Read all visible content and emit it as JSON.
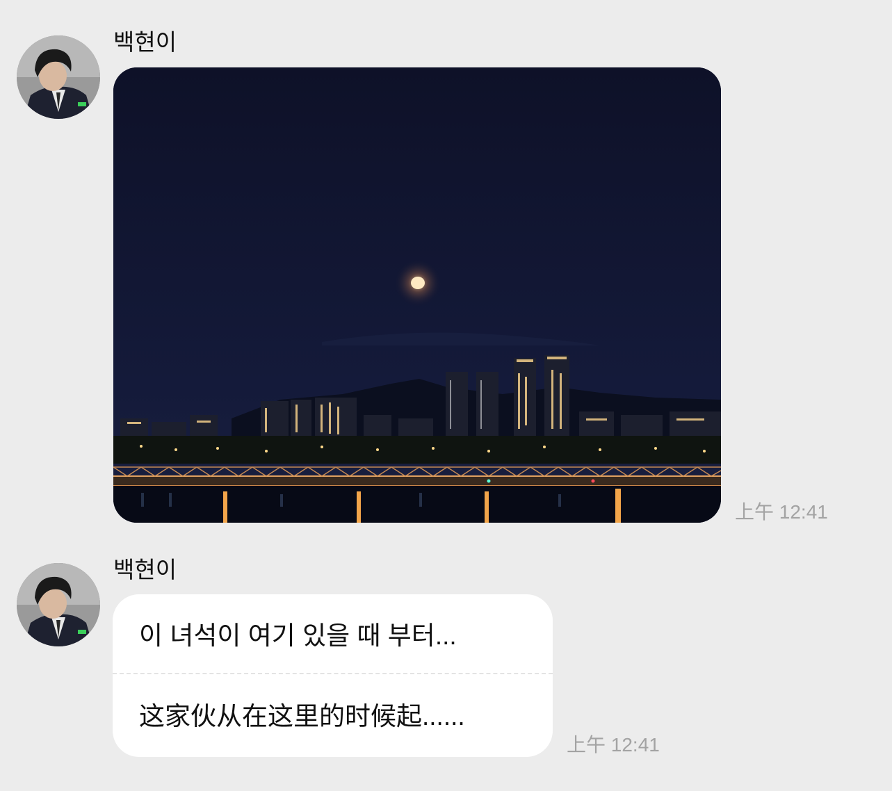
{
  "messages": [
    {
      "sender": "백현이",
      "type": "image",
      "image_alt": "night-city-moon-photo",
      "time": "上午 12:41"
    },
    {
      "sender": "백현이",
      "type": "text",
      "original": "이 녀석이 여기 있을 때 부터...",
      "translation": "这家伙从在这里的时候起......",
      "time": "上午 12:41"
    }
  ],
  "colors": {
    "background": "#ececec",
    "bubble": "#ffffff",
    "timestamp": "#a3a3a3",
    "sky": "#10132b"
  }
}
